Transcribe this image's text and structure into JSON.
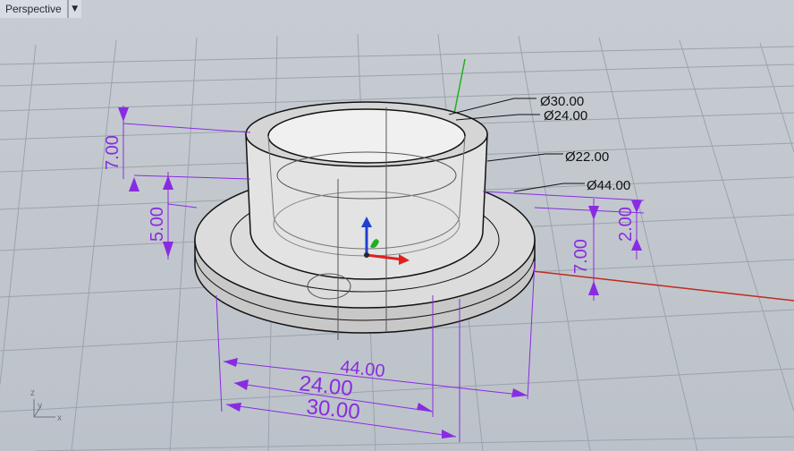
{
  "viewport": {
    "title": "Perspective",
    "menu_icon": "chevron-down-icon"
  },
  "callouts": {
    "d30": "Ø30.00",
    "d24": "Ø24.00",
    "d22": "Ø22.00",
    "d44": "Ø44.00"
  },
  "dimensions": {
    "h7_left": "7.00",
    "h5_left": "5.00",
    "h2_right": "2.00",
    "h7_right": "7.00",
    "w44": "44.00",
    "w24": "24.00",
    "w30": "30.00"
  },
  "axes_indicator": {
    "z": "z",
    "y": "y",
    "x": "x"
  },
  "colors": {
    "dimension": "#8a2be2",
    "x_axis": "#e02020",
    "y_axis": "#1fb01f",
    "z_axis": "#2040d0",
    "grid": "#9aa3ad"
  }
}
